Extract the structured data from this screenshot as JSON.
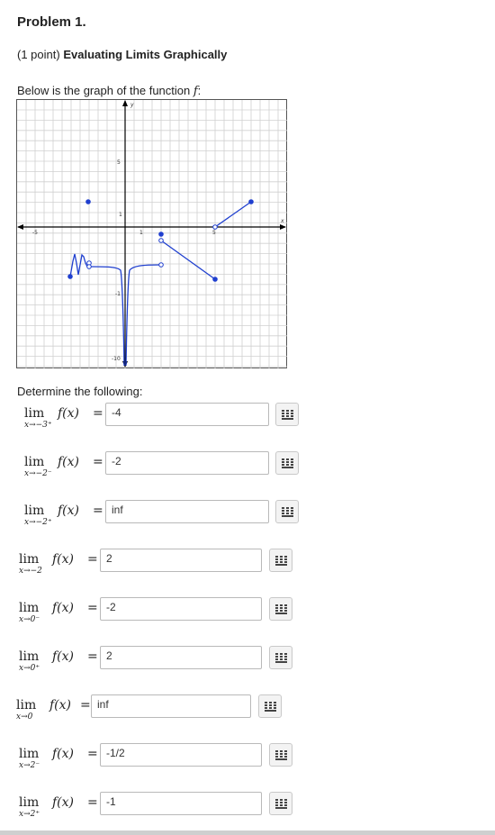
{
  "header": {
    "problem_title": "Problem 1.",
    "points": "(1 point)",
    "problem_name": "Evaluating Limits Graphically"
  },
  "intro": {
    "text": "Below is the graph of the function",
    "function_symbol": "f",
    "colon": ":"
  },
  "graph": {
    "x_axis_label": "x",
    "y_axis_label": "y",
    "tick_labels": {
      "x_neg5": "-5",
      "x_1": "1",
      "x_5": "5",
      "y_5": "5",
      "y_1": "1",
      "y_neg1": "-1",
      "y_neg10": "-10"
    },
    "xlim": [
      -6.25,
      6.25
    ],
    "ylim": [
      -11.25,
      10.0
    ],
    "curve_color": "#1f3fcf",
    "axis_color": "#000000",
    "grid_color": "#d0d0d0"
  },
  "questions": {
    "determine_label": "Determine the following:",
    "rows": [
      {
        "lim": "lim",
        "approach": "x→−3⁺",
        "fx": "f(x)",
        "eq": "=",
        "answer": "-4"
      },
      {
        "lim": "lim",
        "approach": "x→−2⁻",
        "fx": "f(x)",
        "eq": "=",
        "answer": "-2"
      },
      {
        "lim": "lim",
        "approach": "x→−2⁺",
        "fx": "f(x)",
        "eq": "=",
        "answer": "inf"
      },
      {
        "lim": "lim",
        "approach": "x→−2",
        "fx": "f(x)",
        "eq": "=",
        "answer": "2"
      },
      {
        "lim": "lim",
        "approach": "x→0⁻",
        "fx": "f(x)",
        "eq": "=",
        "answer": "-2"
      },
      {
        "lim": "lim",
        "approach": "x→0⁺",
        "fx": "f(x)",
        "eq": "=",
        "answer": "2"
      },
      {
        "lim": "lim",
        "approach": "x→0",
        "fx": "f(x)",
        "eq": "=",
        "answer": "inf"
      },
      {
        "lim": "lim",
        "approach": "x→2⁻",
        "fx": "f(x)",
        "eq": "=",
        "answer": "-1/2"
      },
      {
        "lim": "lim",
        "approach": "x→2⁺",
        "fx": "f(x)",
        "eq": "=",
        "answer": "-1"
      }
    ]
  },
  "icons": {
    "answer_tool": "grid-icon"
  }
}
